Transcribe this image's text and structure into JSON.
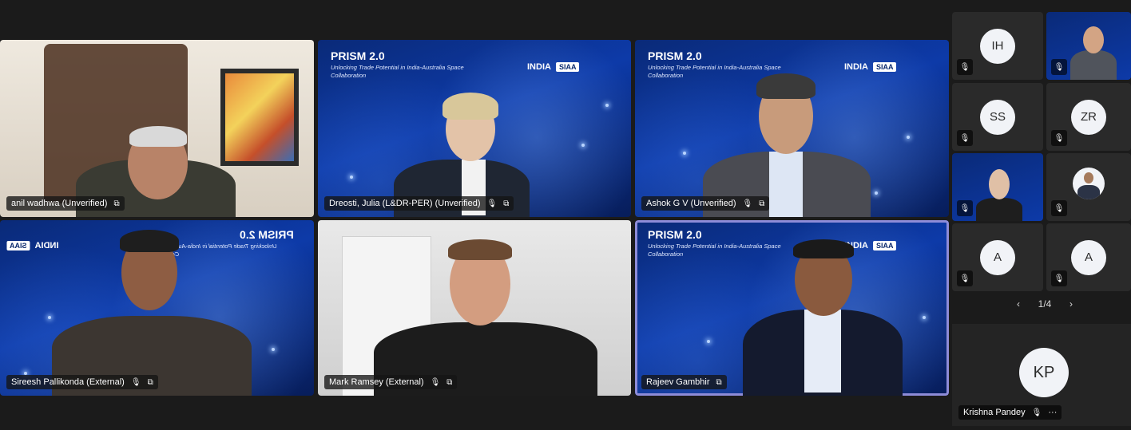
{
  "tiles": [
    {
      "name": "anil wadhwa (Unverified)"
    },
    {
      "name": "Dreosti, Julia (L&DR-PER) (Unverified)"
    },
    {
      "name": "Ashok G V (Unverified)"
    },
    {
      "name": "Sireesh Pallikonda (External)"
    },
    {
      "name": "Mark Ramsey (External)"
    },
    {
      "name": "Rajeev Gambhir"
    }
  ],
  "prism": {
    "title": "PRISM 2.0",
    "subtitle": "Unlocking Trade Potential in India-Australia Space Collaboration",
    "india_logo": "INDIA",
    "siaa_logo": "SIAA"
  },
  "side_participants": [
    {
      "initials": "IH"
    },
    {
      "initials": ""
    },
    {
      "initials": "SS"
    },
    {
      "initials": "ZR"
    },
    {
      "initials": ""
    },
    {
      "initials": ""
    },
    {
      "initials": "A"
    },
    {
      "initials": "A"
    }
  ],
  "pager": {
    "label": "1/4",
    "prev": "‹",
    "next": "›"
  },
  "presenter_panel": {
    "initials": "KP",
    "name": "Krishna Pandey",
    "more": "···"
  },
  "icons": {
    "mic": "🎙",
    "screen": "⧉"
  },
  "colors": {
    "accent_border": "#8e8cd8",
    "background": "#1b1b1b"
  }
}
